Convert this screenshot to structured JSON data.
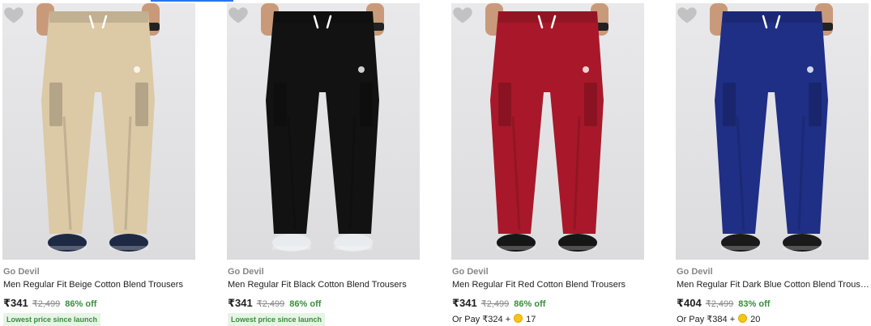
{
  "products": [
    {
      "brand": "Go Devil",
      "title": "Men Regular Fit Beige Cotton Blend Trousers",
      "price": "₹341",
      "mrp": "₹2,499",
      "discount": "86% off",
      "badge": "Lowest price since launch",
      "pant_color": "#dcc9a6",
      "shoe_color": "#1e2a44",
      "image_icon": "trousers-image"
    },
    {
      "brand": "Go Devil",
      "title": "Men Regular Fit Black Cotton Blend Trousers",
      "price": "₹341",
      "mrp": "₹2,499",
      "discount": "86% off",
      "badge": "Lowest price since launch",
      "pant_color": "#121212",
      "shoe_color": "#e8ecef",
      "image_icon": "trousers-image"
    },
    {
      "brand": "Go Devil",
      "title": "Men Regular Fit Red Cotton Blend Trousers",
      "price": "₹341",
      "mrp": "₹2,499",
      "discount": "86% off",
      "or_pay_text": "Or Pay ₹324 +",
      "coins": "17",
      "pant_color": "#a8182a",
      "shoe_color": "#161616",
      "image_icon": "trousers-image"
    },
    {
      "brand": "Go Devil",
      "title": "Men Regular Fit Dark Blue Cotton Blend Trousers",
      "price": "₹404",
      "mrp": "₹2,499",
      "discount": "83% off",
      "or_pay_text": "Or Pay ₹384 +",
      "coins": "20",
      "pant_color": "#1f2f86",
      "shoe_color": "#1a1a1a",
      "image_icon": "trousers-image"
    }
  ],
  "colors": {
    "discount_green": "#388e3c",
    "badge_bg": "#e6f4e6",
    "muted_gray": "#878787",
    "text_dark": "#212121",
    "coin_gold": "#f5c518",
    "wishlist_gray": "#c2c2c2"
  },
  "icons": {
    "wishlist": "heart-icon",
    "coin": "supercoin-icon"
  }
}
